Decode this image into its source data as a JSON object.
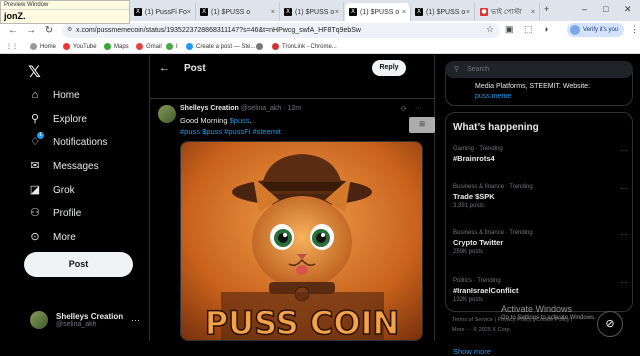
{
  "preview_window": {
    "title": "Preview Window",
    "text": "jonZ."
  },
  "browser": {
    "tabs": [
      {
        "label": "PussFi Fo",
        "active": false
      },
      {
        "label": "(1) PussFi Fo",
        "active": false
      },
      {
        "label": "(1) $PUSS o",
        "active": false
      },
      {
        "label": "(1) $PUSS o",
        "active": false
      },
      {
        "label": "(1) $PUSS o",
        "active": true
      },
      {
        "label": "(1) $PUSS o",
        "active": false
      },
      {
        "label": "ভাই পোস্টা",
        "active": false
      }
    ],
    "url": "x.com/pussmemecoin/status/1935223728868311147?s=46&t=nHPwcg_swfA_HF8Tq9ebSw",
    "verify_label": "Verify it's you",
    "bookmarks": [
      "Home",
      "YouTube",
      "Maps",
      "Gmail",
      "I",
      "Create a post — Ste...",
      "",
      "TronLink - Chrome..."
    ]
  },
  "sidebar": {
    "items": [
      {
        "label": "Home",
        "icon": "home-icon"
      },
      {
        "label": "Explore",
        "icon": "search-icon"
      },
      {
        "label": "Notifications",
        "icon": "bell-icon",
        "badge": "1"
      },
      {
        "label": "Messages",
        "icon": "mail-icon"
      },
      {
        "label": "Grok",
        "icon": "grok-icon"
      },
      {
        "label": "Profile",
        "icon": "person-icon"
      },
      {
        "label": "More",
        "icon": "more-circle-icon"
      }
    ],
    "post_label": "Post",
    "account": {
      "name": "Shelleys Creation",
      "handle": "@selina_akh"
    }
  },
  "main": {
    "title": "Post",
    "reply_label": "Reply",
    "tweet": {
      "name": "Shelleys Creation",
      "handle": "@selina_akh",
      "time": "· 12m",
      "text_prefix": "Good Morning ",
      "text_tag": "$puss",
      "text_suffix": ".",
      "hashtags": "#puss $puss #pussFi #steemit",
      "image_caption": "PUSS COIN"
    }
  },
  "right": {
    "search_placeholder": "Search",
    "bio": {
      "text": "Media Platforms, STEEMIT. Website:",
      "link": "puss.meme"
    },
    "trends_title": "What’s happening",
    "trends": [
      {
        "category": "Gaming · Trending",
        "name": "#Brainrots4",
        "count": ""
      },
      {
        "category": "Business & finance · Trending",
        "name": "Trade $SPK",
        "count": "3,391 posts"
      },
      {
        "category": "Business & finance · Trending",
        "name": "Crypto Twitter",
        "count": "259K posts"
      },
      {
        "category": "Politics · Trending",
        "name": "#IranIsraelConflict",
        "count": "132K posts"
      }
    ],
    "show_more": "Show more",
    "footer_line1": "Terms of Service | Privacy Policy | Cookie Policy |",
    "footer_line2": "More ··· © 2025 X Corp."
  },
  "os_overlay": {
    "activate_title": "Activate Windows",
    "activate_sub": "Go to Settings to activate Windows."
  },
  "colors": {
    "accent": "#1d9bf0",
    "background": "#000000",
    "text": "#e7e9ea",
    "muted": "#71767b"
  }
}
